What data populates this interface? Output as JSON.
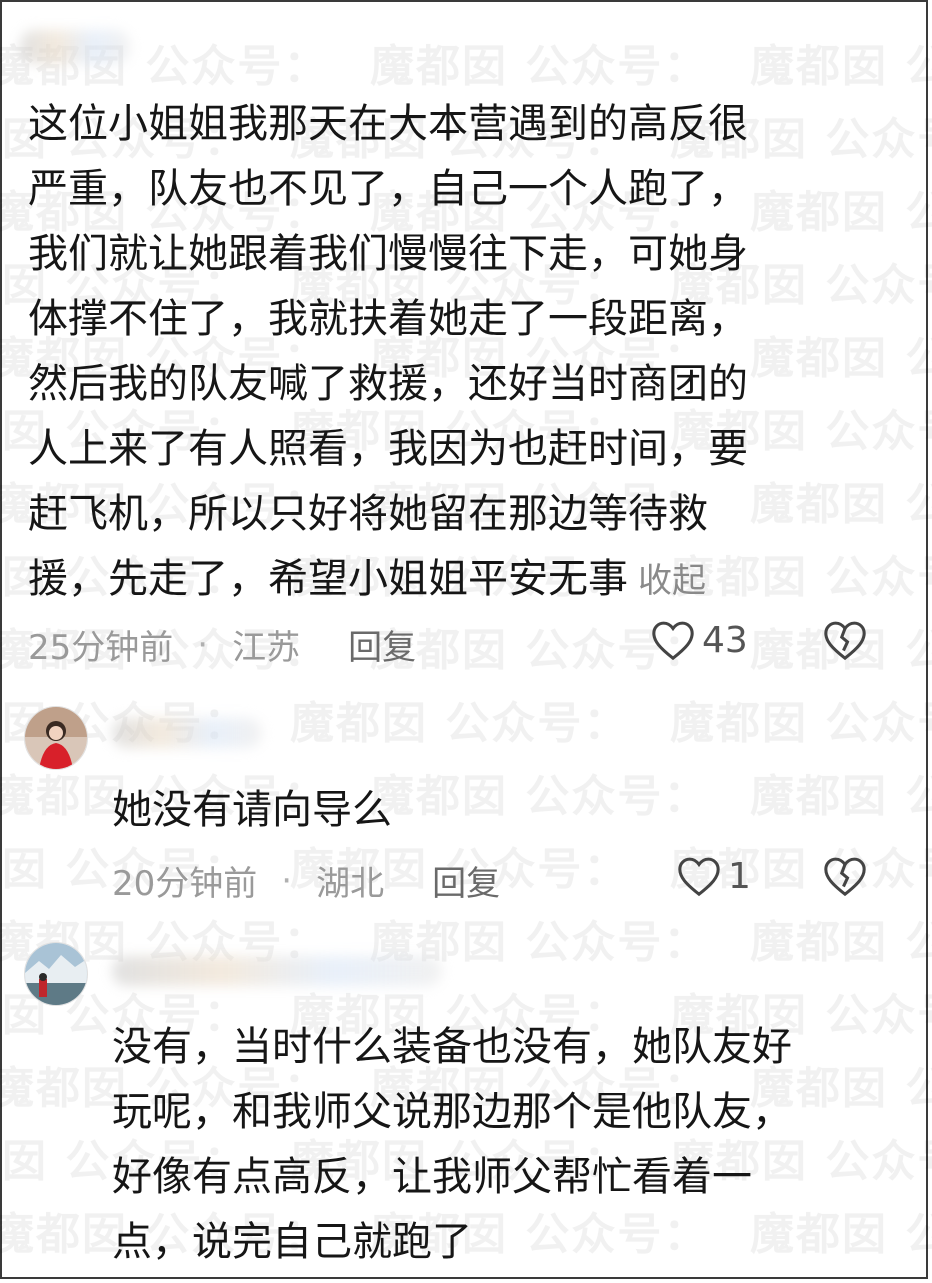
{
  "watermark": "魔都囡 公众号：",
  "comments": [
    {
      "text": "这位小姐姐我那天在大本营遇到的高反很\n严重，队友也不见了，自己一个人跑了，\n我们就让她跟着我们慢慢往下走，可她身\n体撑不住了，我就扶着她走了一段距离，\n然后我的队友喊了救援，还好当时商团的\n人上来了有人照看，我因为也赶时间，要\n赶飞机，所以只好将她留在那边等待救\n援，先走了，希望小姐姐平安无事",
      "collapse_label": "收起",
      "time": "25分钟前",
      "location": "江苏",
      "reply_label": "回复",
      "likes": "43"
    },
    {
      "text": "她没有请向导么",
      "time": "20分钟前",
      "location": "湖北",
      "reply_label": "回复",
      "likes": "1"
    },
    {
      "text": "没有，当时什么装备也没有，她队友好\n玩呢，和我师父说那边那个是他队友，\n好像有点高反，让我师父帮忙看着一\n点，说完自己就跑了"
    }
  ],
  "colors": {
    "text": "#161616",
    "meta": "#9a9a9a",
    "reply": "#6a6a6a",
    "border": "#3a3a3a"
  },
  "icons": [
    "heart-outline-icon",
    "broken-heart-icon"
  ]
}
